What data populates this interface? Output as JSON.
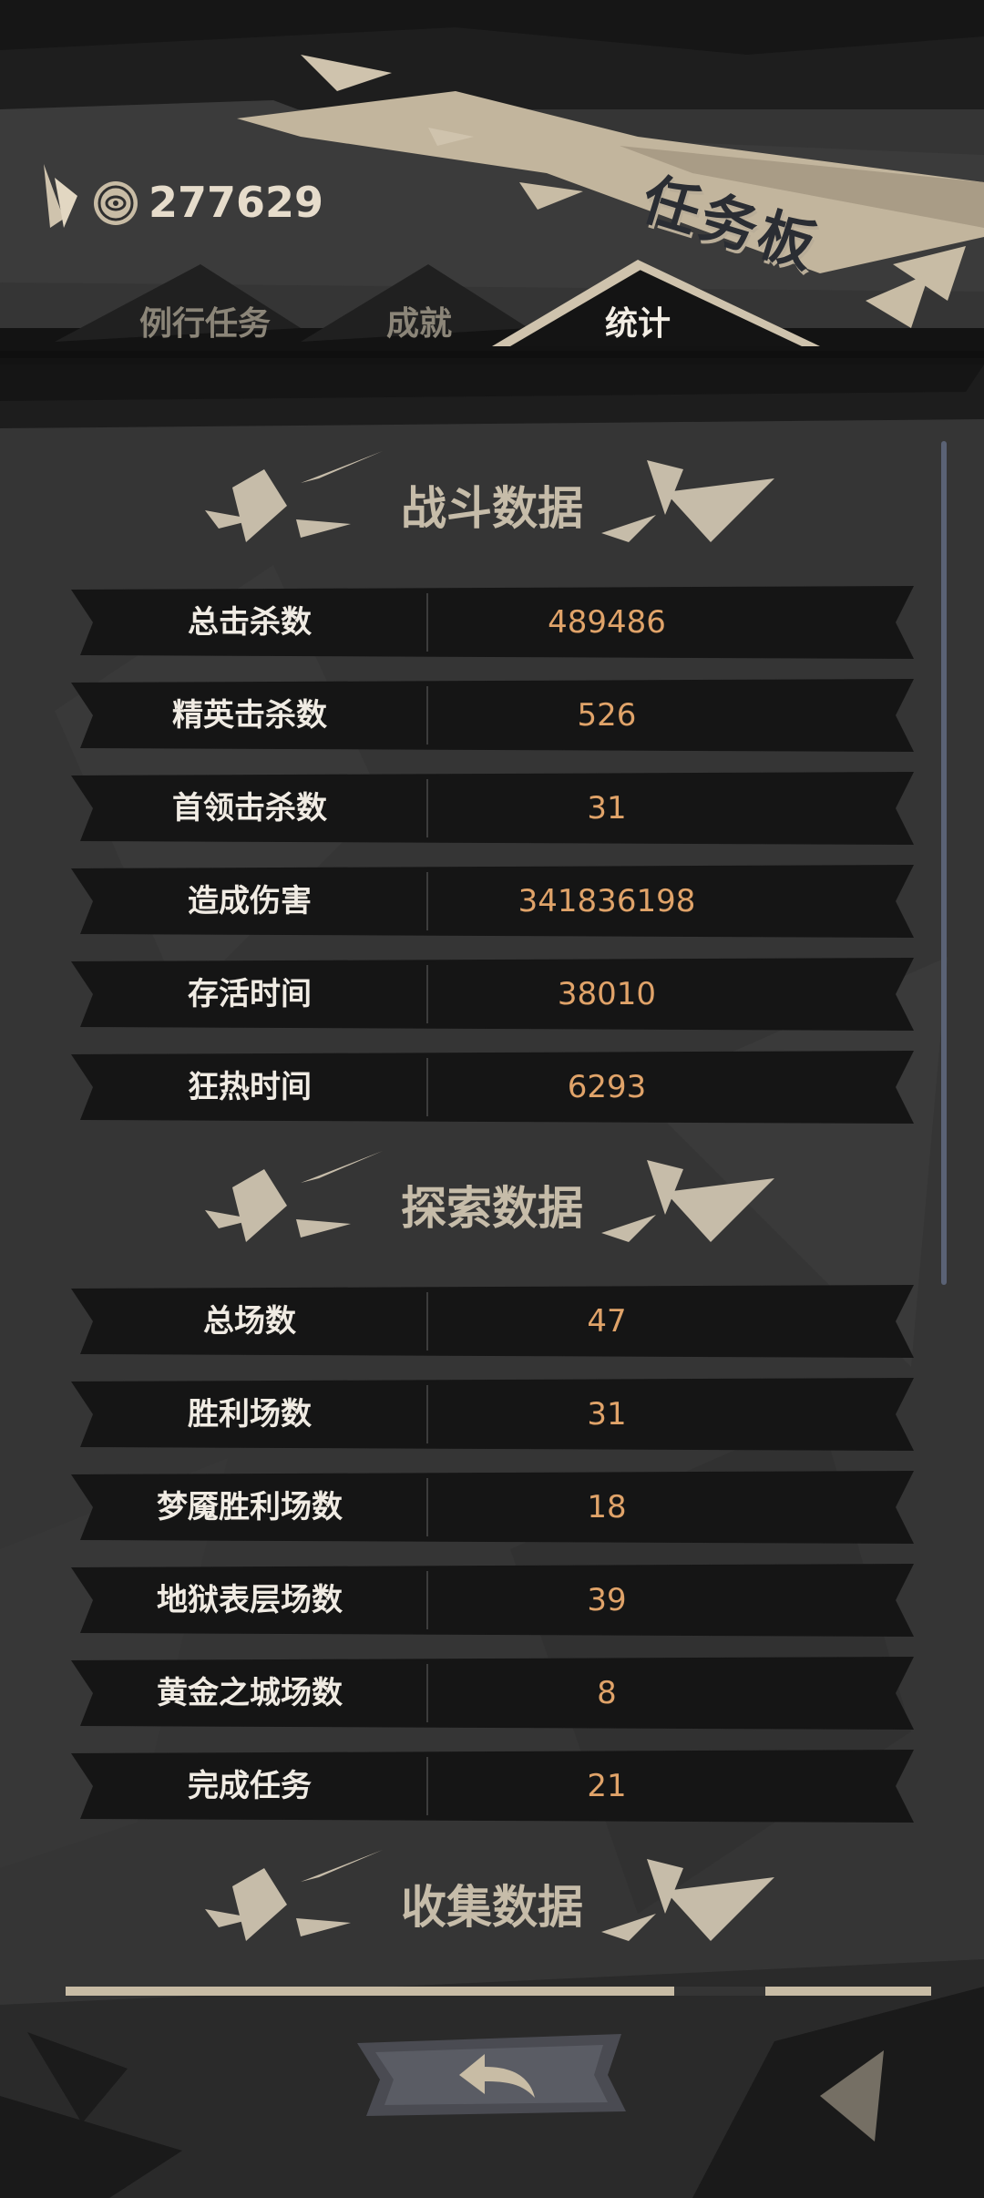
{
  "header": {
    "coin_icon": "coin-icon",
    "currency_value": "277629",
    "board_title": "任务板"
  },
  "tabs": [
    {
      "label": "例行任务",
      "active": false
    },
    {
      "label": "成就",
      "active": false
    },
    {
      "label": "统计",
      "active": true
    }
  ],
  "sections": [
    {
      "title": "战斗数据",
      "rows": [
        {
          "label": "总击杀数",
          "value": "489486"
        },
        {
          "label": "精英击杀数",
          "value": "526"
        },
        {
          "label": "首领击杀数",
          "value": "31"
        },
        {
          "label": "造成伤害",
          "value": "341836198"
        },
        {
          "label": "存活时间",
          "value": "38010"
        },
        {
          "label": "狂热时间",
          "value": "6293"
        }
      ]
    },
    {
      "title": "探索数据",
      "rows": [
        {
          "label": "总场数",
          "value": "47"
        },
        {
          "label": "胜利场数",
          "value": "31"
        },
        {
          "label": "梦魇胜利场数",
          "value": "18"
        },
        {
          "label": "地狱表层场数",
          "value": "39"
        },
        {
          "label": "黄金之城场数",
          "value": "8"
        },
        {
          "label": "完成任务",
          "value": "21"
        }
      ]
    },
    {
      "title": "收集数据",
      "rows": []
    }
  ],
  "footer": {
    "back_icon": "back-arrow-icon"
  },
  "colors": {
    "background": "#333333",
    "accent_beige": "#c6bca9",
    "value_orange": "#e0a369",
    "row_dark": "#151515"
  }
}
